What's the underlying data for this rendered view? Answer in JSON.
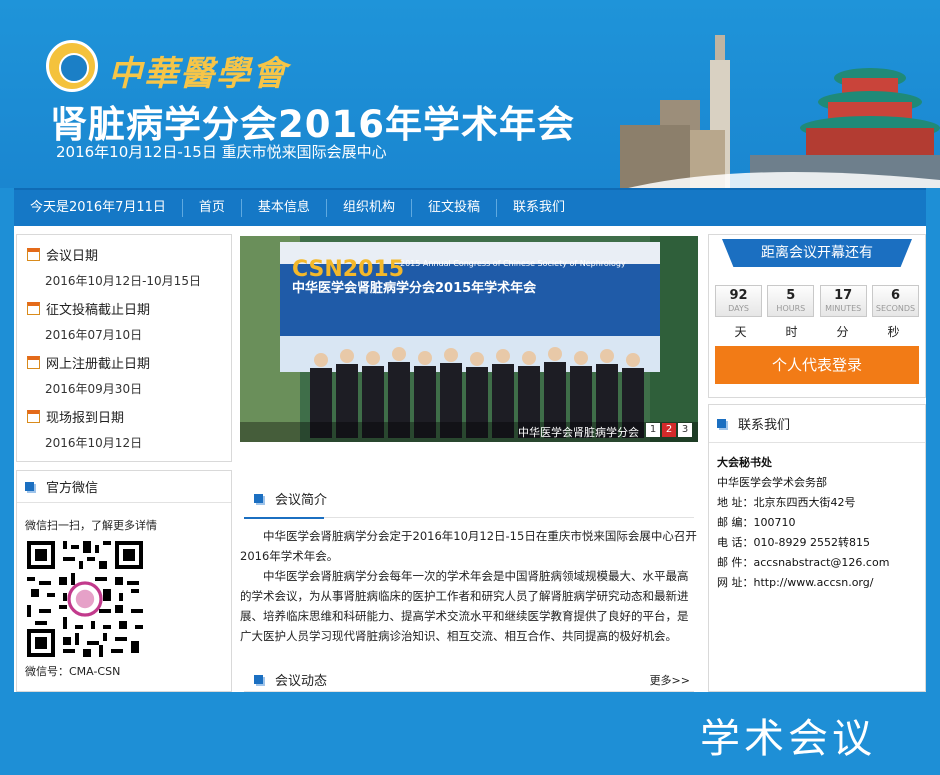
{
  "header": {
    "org_name": "中華醫學會",
    "title": "肾脏病学分会2016年学术年会",
    "subtitle": "2016年10月12日-15日  重庆市悦来国际会展中心"
  },
  "nav": {
    "today": "今天是2016年7月11日",
    "items": [
      "首页",
      "基本信息",
      "组织机构",
      "征文投稿",
      "联系我们"
    ]
  },
  "dates": [
    {
      "label": "会议日期",
      "value": "2016年10月12日-10月15日"
    },
    {
      "label": "征文投稿截止日期",
      "value": "2016年07月10日"
    },
    {
      "label": "网上注册截止日期",
      "value": "2016年09月30日"
    },
    {
      "label": "现场报到日期",
      "value": "2016年10月12日"
    }
  ],
  "wechat": {
    "title": "官方微信",
    "scan_text": "微信扫一扫，了解更多详情",
    "id_text": "微信号：CMA-CSN"
  },
  "banner": {
    "logo_text": "CSN2015",
    "en_title": "2015 Annual Congress of Chinese Society of Nephrology",
    "cn_title": "中华医学会肾脏病学分会2015年学术年会",
    "caption": "中华医学会肾脏病学分会",
    "slides": [
      "1",
      "2",
      "3"
    ],
    "active_slide": "2"
  },
  "intro": {
    "title": "会议简介",
    "p1": "中华医学会肾脏病学分会定于2016年10月12日-15日在重庆市悦来国际会展中心召开2016年学术年会。",
    "p2": "中华医学会肾脏病学分会每年一次的学术年会是中国肾脏病领域规模最大、水平最高的学术会议，为从事肾脏病临床的医护工作者和研究人员了解肾脏病学研究动态和最新进展、培养临床思维和科研能力、提高学术交流水平和继续医学教育提供了良好的平台，是广大医护人员学习现代肾脏病诊治知识、相互交流、相互合作、共同提高的极好机会。"
  },
  "news": {
    "title": "会议动态",
    "more": "更多>>"
  },
  "countdown": {
    "title": "距离会议开幕还有",
    "boxes": [
      {
        "num": "92",
        "unit": "DAYS"
      },
      {
        "num": "5",
        "unit": "HOURS"
      },
      {
        "num": "17",
        "unit": "MINUTES"
      },
      {
        "num": "6",
        "unit": "SECONDS"
      }
    ],
    "labels": [
      "天",
      "时",
      "分",
      "秒"
    ],
    "login": "个人代表登录"
  },
  "contact": {
    "title": "联系我们",
    "lines": [
      "大会秘书处",
      "中华医学会学术会务部",
      "地 址：北京东四西大街42号",
      "邮 编：100710",
      "电 话：010-8929 2552转815",
      "邮 件：accsnabstract@126.com",
      "网 址：http://www.accsn.org/"
    ]
  },
  "footer": {
    "text": "学术会议"
  },
  "colors": {
    "primary": "#1e8fd6",
    "nav": "#1578c6",
    "accent": "#f27b16",
    "gold": "#f6c548"
  }
}
